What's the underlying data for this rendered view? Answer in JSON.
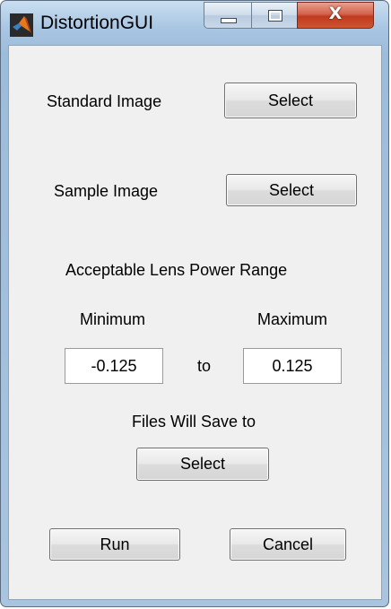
{
  "window": {
    "title": "DistortionGUI",
    "icon": "matlab-logo-icon",
    "close_glyph": "X",
    "colors": {
      "title_bar": "#a9c6e3",
      "close_button": "#c0391f",
      "client_bg": "#f0f0f0"
    }
  },
  "standard_image": {
    "label": "Standard Image",
    "button": "Select"
  },
  "sample_image": {
    "label": "Sample Image",
    "button": "Select"
  },
  "lens_power": {
    "heading": "Acceptable Lens Power Range",
    "min_label": "Minimum",
    "max_label": "Maximum",
    "min_value": "-0.125",
    "separator": "to",
    "max_value": "0.125"
  },
  "save_location": {
    "label": "Files Will Save to",
    "button": "Select"
  },
  "actions": {
    "run": "Run",
    "cancel": "Cancel"
  }
}
